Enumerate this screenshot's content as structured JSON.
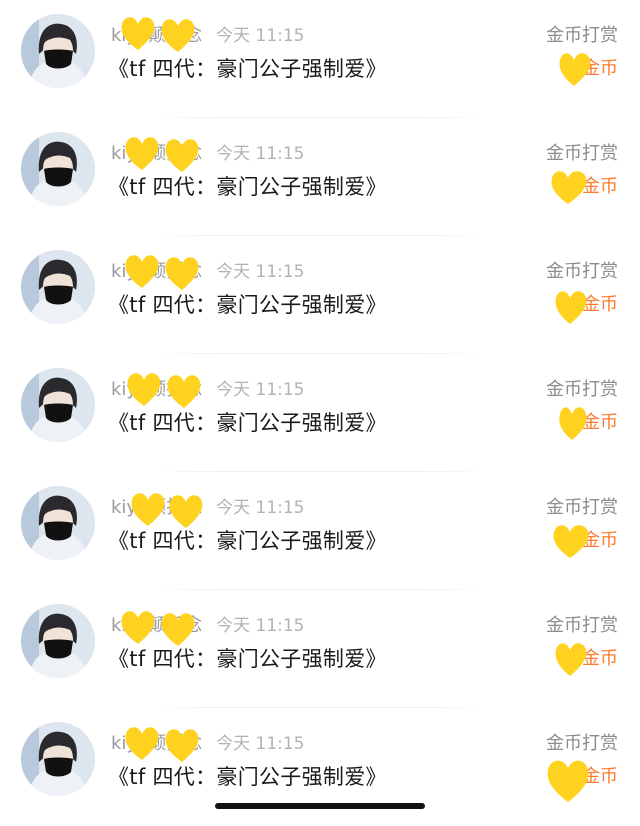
{
  "messages": [
    {
      "username": "kiyo颠折念",
      "time": "今天 11:15",
      "title": "《tf 四代：豪门公子强制爱》",
      "action": "金币打赏",
      "coins": "金币"
    },
    {
      "username": "kiyo颠折念",
      "time": "今天 11:15",
      "title": "《tf 四代：豪门公子强制爱》",
      "action": "金币打赏",
      "coins": "金币"
    },
    {
      "username": "kiyo颠折念",
      "time": "今天 11:15",
      "title": "《tf 四代：豪门公子强制爱》",
      "action": "金币打赏",
      "coins": "金币"
    },
    {
      "username": "kiyo颠折念",
      "time": "今天 11:15",
      "title": "《tf 四代：豪门公子强制爱》",
      "action": "金币打赏",
      "coins": "金币"
    },
    {
      "username": "kiyo颠折念",
      "time": "今天 11:15",
      "title": "《tf 四代：豪门公子强制爱》",
      "action": "金币打赏",
      "coins": "金币"
    },
    {
      "username": "kiyo颠折念",
      "time": "今天 11:15",
      "title": "《tf 四代：豪门公子强制爱》",
      "action": "金币打赏",
      "coins": "金币"
    },
    {
      "username": "kiyo颠折念",
      "time": "今天 11:15",
      "title": "《tf 四代：豪门公子强制爱》",
      "action": "金币打赏",
      "coins": "金币"
    }
  ],
  "colors": {
    "username": "#9a9a9a",
    "time": "#b3b3b3",
    "title": "#1a1a1a",
    "action": "#8c8c8c",
    "coins": "#ff7a2e",
    "heart_sticker": "#ffd21f"
  },
  "icons": {
    "avatar": "avatar-photo",
    "sticker": "yellow-heart-doodle"
  }
}
